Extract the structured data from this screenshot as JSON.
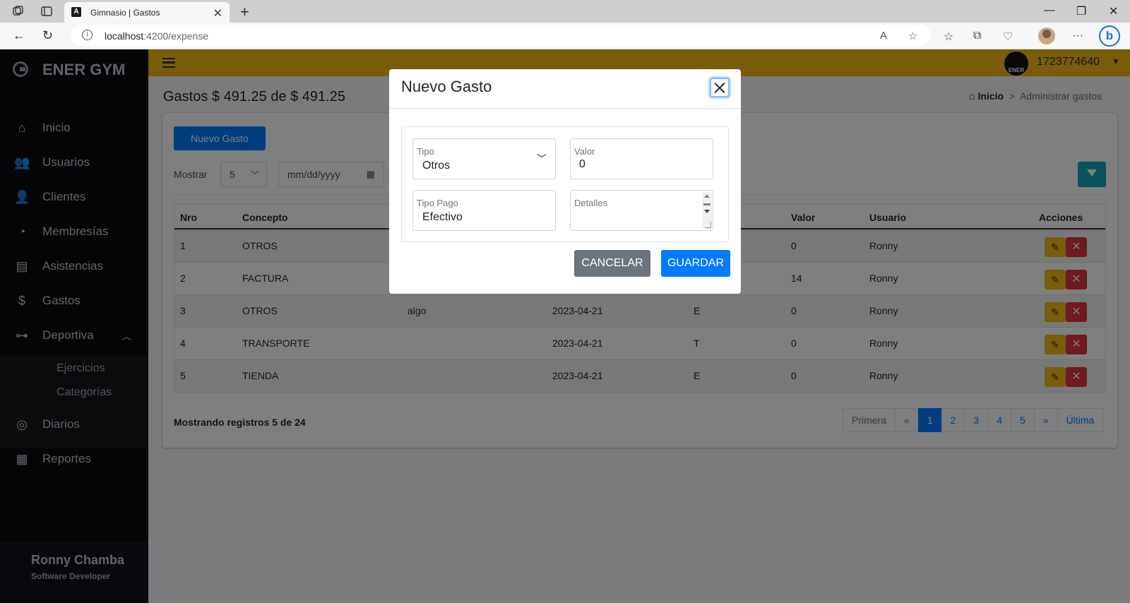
{
  "browser": {
    "tab_title": "Gimnasio | Gastos",
    "url_host": "localhost",
    "url_rest": ":4200/expense"
  },
  "sidebar": {
    "brand": "ENER GYM",
    "items": [
      {
        "label": "Inicio",
        "icon": "home-icon"
      },
      {
        "label": "Usuarios",
        "icon": "users-icon"
      },
      {
        "label": "Clientes",
        "icon": "clients-icon"
      },
      {
        "label": "Membresías",
        "icon": "membership-icon"
      },
      {
        "label": "Asistencias",
        "icon": "attendance-icon"
      },
      {
        "label": "Gastos",
        "icon": "expenses-icon"
      },
      {
        "label": "Deportiva",
        "icon": "dumbbell-icon"
      },
      {
        "label": "Diarios",
        "icon": "compass-icon"
      },
      {
        "label": "Reportes",
        "icon": "report-icon"
      }
    ],
    "subitems": [
      "Ejercicios",
      "Categorías"
    ],
    "user_name": "Ronny Chamba",
    "user_role": "Software Developer"
  },
  "topbar": {
    "avatar_text": "ENER",
    "user_id": "1723774640"
  },
  "page": {
    "title": "Gastos $ 491.25 de $ 491.25",
    "breadcrumb_home": "Inicio",
    "breadcrumb_sep": ">",
    "breadcrumb_current": "Administrar gastos"
  },
  "toolbar": {
    "new_label": "Nuevo Gasto",
    "show_label": "Mostrar",
    "show_value": "5",
    "date_placeholder": "mm/dd/yyyy"
  },
  "table": {
    "headers": [
      "Nro",
      "Concepto",
      "Valor",
      "Usuario",
      "Acciones"
    ],
    "rows": [
      {
        "nro": "1",
        "concepto": "OTROS",
        "detalle": "",
        "fecha": "",
        "tipo": "",
        "valor": "0",
        "usuario": "Ronny"
      },
      {
        "nro": "2",
        "concepto": "FACTURA",
        "detalle": "",
        "fecha": "",
        "tipo": "",
        "valor": "14",
        "usuario": "Ronny"
      },
      {
        "nro": "3",
        "concepto": "OTROS",
        "detalle": "algo",
        "fecha": "2023-04-21",
        "tipo": "E",
        "valor": "0",
        "usuario": "Ronny"
      },
      {
        "nro": "4",
        "concepto": "TRANSPORTE",
        "detalle": "",
        "fecha": "2023-04-21",
        "tipo": "T",
        "valor": "0",
        "usuario": "Ronny"
      },
      {
        "nro": "5",
        "concepto": "TIENDA",
        "detalle": "",
        "fecha": "2023-04-21",
        "tipo": "E",
        "valor": "0",
        "usuario": "Ronny"
      }
    ]
  },
  "footer": {
    "records": "Mostrando registros 5 de 24",
    "pages": [
      "Primera",
      "«",
      "1",
      "2",
      "3",
      "4",
      "5",
      "»",
      "Última"
    ],
    "active_page": "1"
  },
  "modal": {
    "title": "Nuevo Gasto",
    "tipo_label": "Tipo",
    "tipo_value": "Otros",
    "valor_label": "Valor",
    "valor_value": "0",
    "tipo_pago_label": "Tipo Pago",
    "tipo_pago_value": "Efectivo",
    "detalles_label": "Detalles",
    "cancel_label": "CANCELAR",
    "save_label": "GUARDAR"
  },
  "colors": {
    "sidebar_bg": "#0a0a0f",
    "topbar_bg": "#f4b915",
    "primary": "#007bff",
    "danger": "#dc3545",
    "info": "#17a2b8"
  }
}
